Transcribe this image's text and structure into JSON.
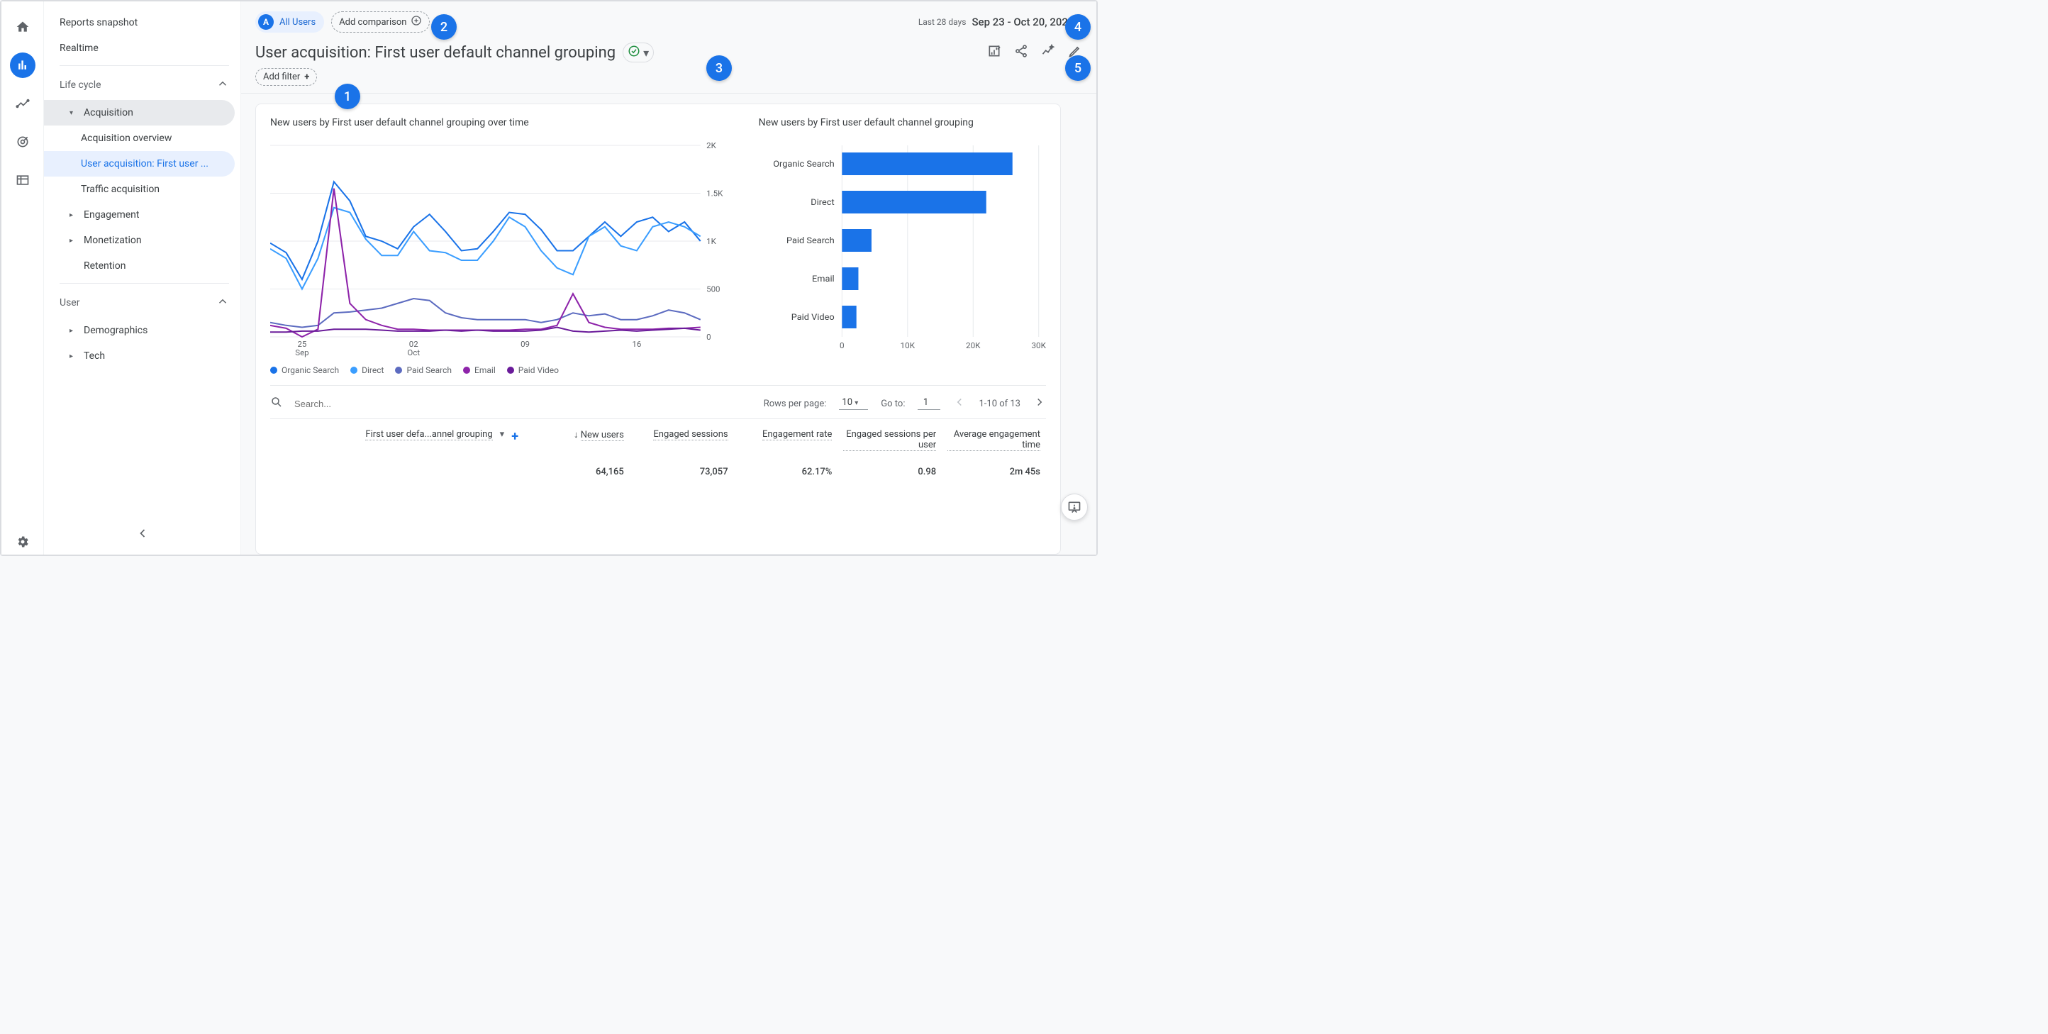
{
  "rail": {
    "home": "home",
    "reports": "reports",
    "explore": "explore",
    "advertising": "advertising",
    "configure": "configure",
    "admin": "admin"
  },
  "nav": {
    "reports_snapshot": "Reports snapshot",
    "realtime": "Realtime",
    "life_cycle": "Life cycle",
    "acquisition": "Acquisition",
    "acquisition_overview": "Acquisition overview",
    "user_acquisition": "User acquisition: First user ...",
    "traffic_acquisition": "Traffic acquisition",
    "engagement": "Engagement",
    "monetization": "Monetization",
    "retention": "Retention",
    "user": "User",
    "demographics": "Demographics",
    "tech": "Tech"
  },
  "segment": {
    "badge": "A",
    "label": "All Users"
  },
  "add_comparison": "Add comparison",
  "add_filter": "Add filter",
  "date": {
    "label": "Last 28 days",
    "range": "Sep 23 - Oct 20, 2022"
  },
  "title": "User acquisition: First user default channel grouping",
  "chart": {
    "line_title": "New users by First user default channel grouping over time",
    "bar_title": "New users by First user default channel grouping"
  },
  "legend": {
    "organic": "Organic Search",
    "direct": "Direct",
    "paid_search": "Paid Search",
    "email": "Email",
    "paid_video": "Paid Video"
  },
  "colors": {
    "organic": "#1a73e8",
    "direct": "#3b9eff",
    "paid_search": "#5c6bc0",
    "email": "#8e24aa",
    "paid_video": "#6a1b9a"
  },
  "table_ctrl": {
    "search_placeholder": "Search...",
    "rows_per_page": "Rows per page:",
    "rows_value": "10",
    "goto": "Go to:",
    "goto_value": "1",
    "range": "1-10 of 13"
  },
  "table": {
    "dimension": "First user defa...annel grouping",
    "metrics": {
      "new_users": "New users",
      "engaged_sessions": "Engaged sessions",
      "engagement_rate": "Engagement rate",
      "sessions_per_user": "Engaged sessions per user",
      "avg_time": "Average engagement time"
    },
    "totals": {
      "new_users": "64,165",
      "engaged_sessions": "73,057",
      "engagement_rate": "62.17%",
      "sessions_per_user": "0.98",
      "avg_time": "2m 45s"
    }
  },
  "annotations": {
    "a1": "1",
    "a2": "2",
    "a3": "3",
    "a4": "4",
    "a5": "5"
  },
  "chart_data": [
    {
      "type": "line",
      "title": "New users by First user default channel grouping over time",
      "ylabel": "",
      "ylim": [
        0,
        2000
      ],
      "yticks": [
        0,
        500,
        1000,
        1500,
        2000
      ],
      "x_categories": [
        "23",
        "24",
        "25",
        "26",
        "27",
        "28",
        "29",
        "30",
        "01",
        "02",
        "03",
        "04",
        "05",
        "06",
        "07",
        "08",
        "09",
        "10",
        "11",
        "12",
        "13",
        "14",
        "15",
        "16",
        "17",
        "18",
        "19",
        "20"
      ],
      "x_tick_labels": [
        "25\nSep",
        "02\nOct",
        "09",
        "16"
      ],
      "series": [
        {
          "name": "Organic Search",
          "color": "#1a73e8",
          "values": [
            980,
            880,
            600,
            1000,
            1620,
            1420,
            1050,
            1000,
            920,
            1150,
            1280,
            1100,
            900,
            920,
            1100,
            1300,
            1280,
            1120,
            900,
            900,
            1050,
            1200,
            1050,
            1200,
            1250,
            1100,
            1200,
            1000
          ]
        },
        {
          "name": "Direct",
          "color": "#3b9eff",
          "values": [
            920,
            820,
            500,
            820,
            1350,
            1300,
            1020,
            850,
            850,
            1100,
            900,
            880,
            800,
            800,
            1000,
            1250,
            1150,
            900,
            720,
            650,
            1050,
            1150,
            950,
            900,
            1150,
            1200,
            1150,
            1050
          ]
        },
        {
          "name": "Paid Search",
          "color": "#5c6bc0",
          "values": [
            150,
            120,
            100,
            120,
            250,
            260,
            280,
            300,
            350,
            400,
            380,
            250,
            200,
            180,
            180,
            180,
            180,
            150,
            180,
            250,
            220,
            240,
            180,
            180,
            220,
            280,
            250,
            180
          ]
        },
        {
          "name": "Email",
          "color": "#8e24aa",
          "values": [
            120,
            90,
            0,
            80,
            1550,
            350,
            180,
            120,
            80,
            80,
            70,
            70,
            70,
            70,
            70,
            70,
            80,
            80,
            120,
            450,
            150,
            100,
            80,
            80,
            80,
            90,
            90,
            100
          ]
        },
        {
          "name": "Paid Video",
          "color": "#6a1b9a",
          "values": [
            50,
            50,
            60,
            60,
            80,
            80,
            80,
            70,
            60,
            60,
            60,
            70,
            60,
            70,
            60,
            60,
            60,
            70,
            100,
            60,
            50,
            60,
            70,
            60,
            70,
            80,
            90,
            70
          ]
        }
      ]
    },
    {
      "type": "bar",
      "orientation": "horizontal",
      "title": "New users by First user default channel grouping",
      "xlim": [
        0,
        30000
      ],
      "xticks": [
        0,
        10000,
        20000,
        30000
      ],
      "categories": [
        "Organic Search",
        "Direct",
        "Paid Search",
        "Email",
        "Paid Video"
      ],
      "values": [
        26000,
        22000,
        4500,
        2500,
        2200
      ],
      "color": "#1a73e8"
    }
  ]
}
